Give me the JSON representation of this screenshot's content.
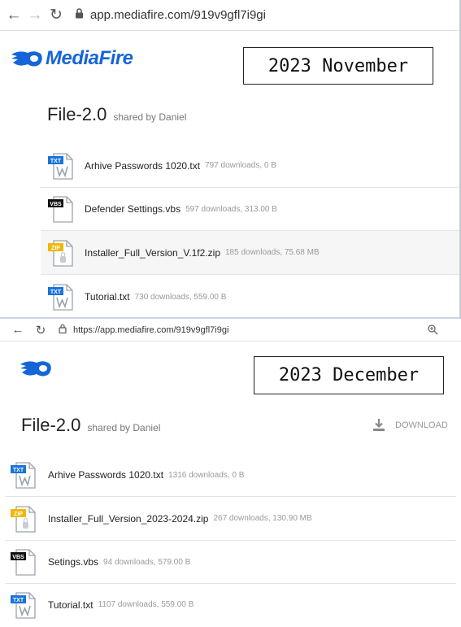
{
  "top": {
    "browser": {
      "url": "app.mediafire.com/919v9gfl7i9gi"
    },
    "logo_text": "MediaFire",
    "date_label": "2023 November",
    "folder": {
      "name": "File-2.0",
      "shared_by": "shared by Daniel"
    },
    "files": [
      {
        "icon": "txt-file-icon",
        "badge": "TXT",
        "name": "Arhive Passwords 1020.txt",
        "meta": "797 downloads, 0 B"
      },
      {
        "icon": "vbs-file-icon",
        "badge": "VBS",
        "name": "Defender Settings.vbs",
        "meta": "597 downloads, 313.00 B"
      },
      {
        "icon": "zip-file-icon",
        "badge": "ZIP",
        "name": "Installer_Full_Version_V.1f2.zip",
        "meta": "185 downloads, 75.68 MB"
      },
      {
        "icon": "txt-file-icon",
        "badge": "TXT",
        "name": "Tutorial.txt",
        "meta": "730 downloads, 559.00 B"
      }
    ]
  },
  "bottom": {
    "browser": {
      "url": "https://app.mediafire.com/919v9gfl7i9gi"
    },
    "date_label": "2023 December",
    "folder": {
      "name": "File-2.0",
      "shared_by": "shared by Daniel"
    },
    "download_label": "DOWNLOAD",
    "files": [
      {
        "icon": "txt-file-icon",
        "badge": "TXT",
        "name": "Arhive Passwords 1020.txt",
        "meta": "1316 downloads, 0 B"
      },
      {
        "icon": "zip-file-icon",
        "badge": "ZIP",
        "name": "Installer_Full_Version_2023-2024.zip",
        "meta": "267 downloads, 130.90 MB"
      },
      {
        "icon": "vbs-file-icon",
        "badge": "VBS",
        "name": "Setings.vbs",
        "meta": "94 downloads, 579.00 B"
      },
      {
        "icon": "txt-file-icon",
        "badge": "TXT",
        "name": "Tutorial.txt",
        "meta": "1107 downloads, 559.00 B"
      }
    ]
  },
  "colors": {
    "brand": "#1565d8",
    "txt_badge": "#1a73d9",
    "vbs_badge": "#111111",
    "zip_badge": "#f2b705"
  }
}
